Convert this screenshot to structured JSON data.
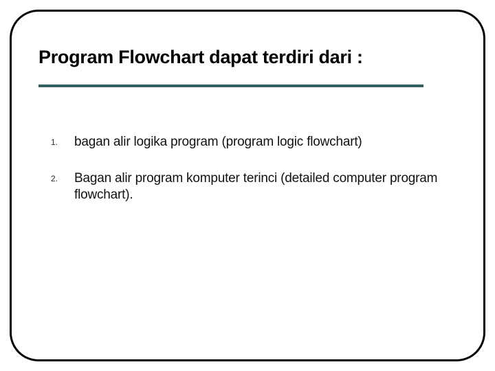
{
  "title": "Program Flowchart dapat terdiri dari :",
  "items": [
    {
      "num": "1.",
      "text": "bagan alir logika  program (program logic flowchart)"
    },
    {
      "num": "2.",
      "text": "Bagan alir program komputer terinci  (detailed computer program flowchart)."
    }
  ],
  "colors": {
    "divider": "#2f5f5f"
  }
}
